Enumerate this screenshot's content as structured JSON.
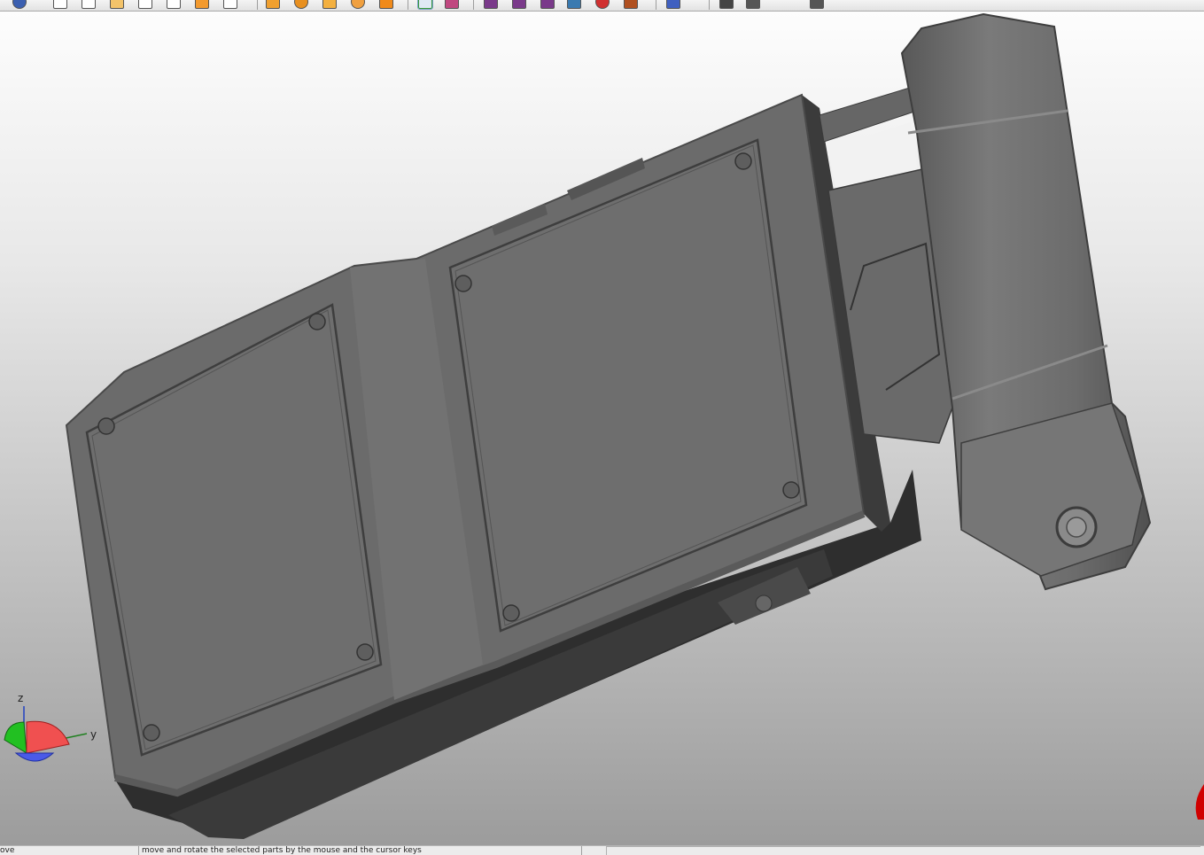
{
  "toolbar": {
    "icons": [
      {
        "name": "info-icon",
        "color": "#3b5fb0"
      },
      {
        "name": "new-document-icon",
        "color": "#ffffff"
      },
      {
        "name": "open-document-icon",
        "color": "#ffffff"
      },
      {
        "name": "import-document-icon",
        "color": "#f3c36a"
      },
      {
        "name": "save-document-icon",
        "color": "#ffffff"
      },
      {
        "name": "save-as-document-icon",
        "color": "#ffffff"
      },
      {
        "name": "export-document-icon",
        "color": "#f39a2e"
      },
      {
        "name": "print-document-icon",
        "color": "#ffffff"
      },
      {
        "name": "orange-tool-icon",
        "color": "#f0a030"
      },
      {
        "name": "orange-gear-icon",
        "color": "#e89020"
      },
      {
        "name": "orange-page-icon",
        "color": "#f3b040"
      },
      {
        "name": "orange-cog-icon",
        "color": "#f0a040"
      },
      {
        "name": "orange-wrench-icon",
        "color": "#f08a1a"
      },
      {
        "name": "select-arrow-icon",
        "color": "#3a9a3a"
      },
      {
        "name": "sketch-icon",
        "color": "#c04880"
      },
      {
        "name": "move-arrow-icon",
        "color": "#7a3a8a"
      },
      {
        "name": "rotate-arrow-icon",
        "color": "#7a3a8a"
      },
      {
        "name": "transform-arrow-icon",
        "color": "#7a3a8a"
      },
      {
        "name": "layers-icon",
        "color": "#3a7ab0"
      },
      {
        "name": "color-sphere-icon",
        "color": "#d03030"
      },
      {
        "name": "material-icon",
        "color": "#b05020"
      },
      {
        "name": "flask-icon",
        "color": "#4060c0"
      },
      {
        "name": "pin-icon",
        "color": "#444444"
      },
      {
        "name": "camera-icon",
        "color": "#555555"
      },
      {
        "name": "pointer-icon",
        "color": "#555555"
      }
    ]
  },
  "axis_triad": {
    "z_label": "z",
    "y_label": "y"
  },
  "statusbar": {
    "left_text": "ove",
    "message": "move and rotate the selected parts by the mouse and the cursor keys",
    "right_text": ""
  },
  "colors": {
    "model_face": "#6a6a6a",
    "model_shadow": "#2f2f2f",
    "highlight": "#d00000"
  }
}
